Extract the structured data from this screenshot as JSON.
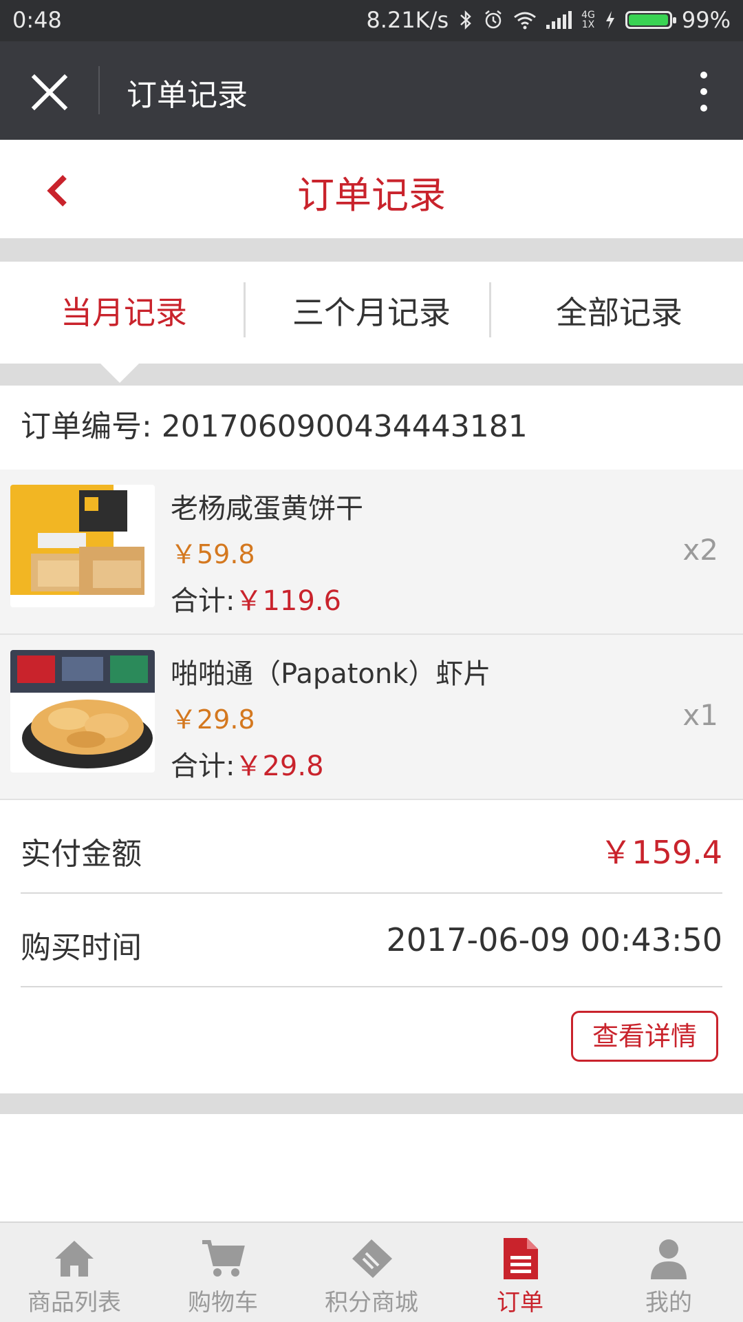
{
  "status": {
    "time": "0:48",
    "speed": "8.21K/s",
    "net": "4G",
    "net_sub": "1X",
    "battery": "99%",
    "battery_level": 0.99
  },
  "titlebar": {
    "title": "订单记录"
  },
  "header": {
    "title": "订单记录"
  },
  "tabs": [
    {
      "label": "当月记录",
      "active": true
    },
    {
      "label": "三个月记录",
      "active": false
    },
    {
      "label": "全部记录",
      "active": false
    }
  ],
  "order": {
    "number_label": "订单编号: 2017060900434443181",
    "items": [
      {
        "name": "老杨咸蛋黄饼干",
        "price": "￥59.8",
        "subtotal_label": "合计:",
        "subtotal": "￥119.6",
        "qty": "x2"
      },
      {
        "name": "啪啪通（Papatonk）虾片",
        "price": "￥29.8",
        "subtotal_label": "合计:",
        "subtotal": "￥29.8",
        "qty": "x1"
      }
    ],
    "paid_label": "实付金额",
    "paid_value": "￥159.4",
    "time_label": "购买时间",
    "time_value": "2017-06-09 00:43:50",
    "detail_button": "查看详情"
  },
  "bottom_nav": [
    {
      "label": "商品列表",
      "icon": "home-icon",
      "active": false
    },
    {
      "label": "购物车",
      "icon": "cart-icon",
      "active": false
    },
    {
      "label": "积分商城",
      "icon": "ticket-icon",
      "active": false
    },
    {
      "label": "订单",
      "icon": "document-icon",
      "active": true
    },
    {
      "label": "我的",
      "icon": "user-icon",
      "active": false
    }
  ],
  "colors": {
    "accent": "#c9232c",
    "price": "#d4781f",
    "titlebar": "#393a3f",
    "statusbar": "#2f3033"
  }
}
